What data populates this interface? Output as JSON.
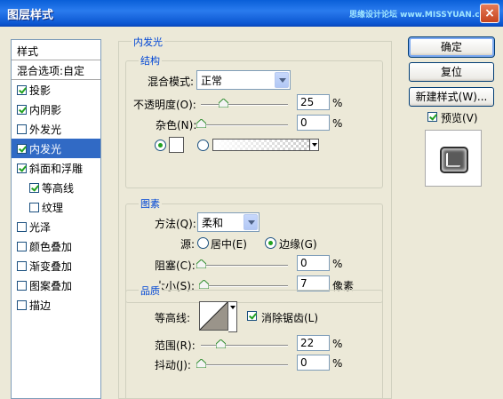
{
  "window": {
    "title": "图层样式",
    "watermark": "思缘设计论坛 www.MISSYUAN.com",
    "close_label": "×"
  },
  "styles_panel": {
    "header": "样式",
    "blend_options": "混合选项:自定",
    "items": [
      {
        "label": "投影",
        "checked": true
      },
      {
        "label": "内阴影",
        "checked": true
      },
      {
        "label": "外发光",
        "checked": false
      },
      {
        "label": "内发光",
        "checked": true,
        "selected": true
      },
      {
        "label": "斜面和浮雕",
        "checked": true
      },
      {
        "label": "等高线",
        "checked": true,
        "sub": true
      },
      {
        "label": "纹理",
        "checked": false,
        "sub": true
      },
      {
        "label": "光泽",
        "checked": false
      },
      {
        "label": "颜色叠加",
        "checked": false
      },
      {
        "label": "渐变叠加",
        "checked": false
      },
      {
        "label": "图案叠加",
        "checked": false
      },
      {
        "label": "描边",
        "checked": false
      }
    ]
  },
  "inner_glow": {
    "title": "内发光",
    "structure": {
      "title": "结构",
      "blend_mode_label": "混合模式:",
      "blend_mode_value": "正常",
      "opacity_label": "不透明度(O):",
      "opacity_value": "25",
      "noise_label": "杂色(N):",
      "noise_value": "0",
      "percent": "%",
      "color_mode": "solid",
      "opacity_level": 25,
      "noise_level": 0
    },
    "elements": {
      "title": "图素",
      "technique_label": "方法(Q):",
      "technique_value": "柔和",
      "source_label": "源:",
      "source_center": "居中(E)",
      "source_edge": "边缘(G)",
      "source_selected": "edge",
      "choke_label": "阻塞(C):",
      "choke_value": "0",
      "size_label": "大小(S):",
      "size_value": "7",
      "size_unit": "像素",
      "percent": "%",
      "choke_level": 0,
      "size_level": 7
    },
    "quality": {
      "title": "品质",
      "contour_label": "等高线:",
      "anti_alias_label": "消除锯齿(L)",
      "anti_alias_checked": true,
      "range_label": "范围(R):",
      "range_value": "22",
      "jitter_label": "抖动(J):",
      "jitter_value": "0",
      "percent": "%",
      "range_level": 22,
      "jitter_level": 0
    }
  },
  "buttons": {
    "ok": "确定",
    "reset": "复位",
    "new_style": "新建样式(W)...",
    "preview_label": "预览(V)",
    "preview_checked": true
  }
}
